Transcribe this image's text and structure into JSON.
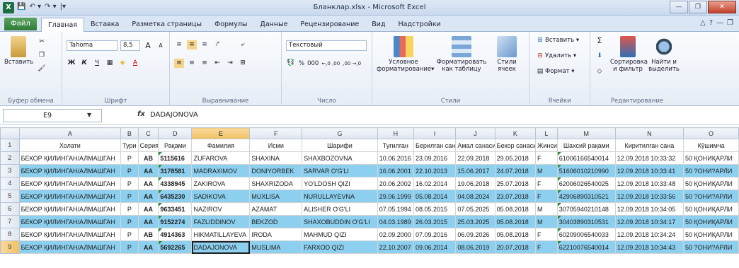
{
  "window": {
    "title": "Бланклар.xlsx - Microsoft Excel",
    "logo": "X",
    "qat": [
      "💾",
      "↶ ▾",
      "↷ ▾",
      "|▾"
    ],
    "buttons": {
      "minimize": "—",
      "restore": "❐",
      "close": "✕"
    }
  },
  "tabs": {
    "file": "Файл",
    "items": [
      "Главная",
      "Вставка",
      "Разметка страницы",
      "Формулы",
      "Данные",
      "Рецензирование",
      "Вид",
      "Надстройки"
    ],
    "help": [
      "△",
      "?",
      "—",
      "❐"
    ]
  },
  "ribbon": {
    "clipboard": {
      "label": "Буфер обмена",
      "paste": "Вставить"
    },
    "font": {
      "label": "Шрифт",
      "name": "Tahoma",
      "size": "8,5",
      "bold": "Ж",
      "italic": "К",
      "underline": "Ч",
      "grow": "A",
      "shrink": "A"
    },
    "alignment": {
      "label": "Выравнивание"
    },
    "number": {
      "label": "Число",
      "format": "Текстовый",
      "percent": "%",
      "thousands": "000",
      "inc": "←,0 ,00",
      "dec": ",00 →,0"
    },
    "styles": {
      "label": "Стили",
      "conditional": "Условное форматирование",
      "conditional_arrow": "▾",
      "as_table": "Форматировать как таблицу",
      "cell_styles": "Стили ячеек"
    },
    "cells": {
      "label": "Ячейки",
      "insert": "Вставить",
      "delete": "Удалить",
      "format": "Формат"
    },
    "editing": {
      "label": "Редактирование",
      "sum": "Σ",
      "sort": "Сортировка и фильтр",
      "find": "Найти и выделить"
    }
  },
  "formula_bar": {
    "cell": "E9",
    "fx": "fx",
    "value": "DADAJONOVA"
  },
  "sheet": {
    "columns": [
      "A",
      "B",
      "C",
      "D",
      "E",
      "F",
      "G",
      "H",
      "I",
      "J",
      "K",
      "L",
      "M",
      "N",
      "O"
    ],
    "header_row": [
      "Холати",
      "Тури",
      "Серия",
      "Рақами",
      "Фамилия",
      "Исми",
      "Шарифи",
      "Туғилган",
      "Берилган сана",
      "Амал санаси",
      "Бекор санаси",
      "Жинси",
      "Шахсий рақами",
      "Киритилган сана",
      "Кўшимча"
    ],
    "rows": [
      [
        "БЕКОР ҚИЛИНГАН/АЛМАШГАН",
        "P",
        "AB",
        "5115616",
        "ZUFAROVA",
        "SHAXINA",
        "SHAXBOZOVNA",
        "10.06.2016",
        "23.09.2016",
        "22.09.2018",
        "29.05.2018",
        "F",
        "61006166540014",
        "12.09.2018 10:33:32",
        "50 ҚОНИҚАРЛИ"
      ],
      [
        "БЕКОР ҚИЛИНГАН/АЛМАШГАН",
        "P",
        "AA",
        "3178581",
        "MADRAXIMOV",
        "DONIYORBEK",
        "SARVAR O'G'LI",
        "16.06.2001",
        "22.10.2013",
        "15.06.2017",
        "24.07.2018",
        "M",
        "51606010210990",
        "12.09.2018 10:33:41",
        "50 ?ОНИ?АРЛИ"
      ],
      [
        "БЕКОР ҚИЛИНГАН/АЛМАШГАН",
        "P",
        "AA",
        "4338945",
        "ZAKIROVA",
        "SHAXRIZODA",
        "YO'LDOSH QIZI",
        "20.06.2002",
        "16.02.2014",
        "19.06.2018",
        "25.07.2018",
        "F",
        "62006026540025",
        "12.09.2018 10:33:48",
        "50 ҚОНИҚАРЛИ"
      ],
      [
        "БЕКОР ҚИЛИНГАН/АЛМАШГАН",
        "P",
        "AA",
        "6435230",
        "SADIKOVA",
        "MUXLISA",
        "NURULLAYEVNA",
        "29.06.1999",
        "05.08.2014",
        "04.08.2024",
        "23.07.2018",
        "F",
        "42906890310521",
        "12.09.2018 10:33:56",
        "50 ?ОНИ?АРЛИ"
      ],
      [
        "БЕКОР ҚИЛИНГАН/АЛМАШГАН",
        "P",
        "AA",
        "9633451",
        "NAZIROV",
        "AZAMAT",
        "ALISHER O'G'LI",
        "07.05.1994",
        "08.05.2015",
        "07.05.2025",
        "05.08.2018",
        "M",
        "30705940210148",
        "12.09.2018 10:34:05",
        "50 ҚОНИҚАРЛИ"
      ],
      [
        "БЕКОР ҚИЛИНГАН/АЛМАШГАН",
        "P",
        "AA",
        "9152274",
        "FAZLIDDINOV",
        "BEKZOD",
        "SHAXOBUDDIN O'G'LI",
        "04.03.1989",
        "26.03.2015",
        "25.03.2025",
        "05.08.2018",
        "M",
        "30403890310531",
        "12.09.2018 10:34:17",
        "50 ҚОНИҚАРЛИ"
      ],
      [
        "БЕКОР ҚИЛИНГАН/АЛМАШГАН",
        "P",
        "AB",
        "4914363",
        "HIKMATILLAYEVA",
        "IRODA",
        "MAHMUD QIZI",
        "02.09.2000",
        "07.09.2016",
        "06.09.2026",
        "05.08.2018",
        "F",
        "60209006540033",
        "12.09.2018 10:34:24",
        "50 ҚОНИҚАРЛИ"
      ],
      [
        "БЕКОР ҚИЛИНГАН/АЛМАШГАН",
        "P",
        "AA",
        "5692265",
        "DADAJONOVA",
        "MUSLIMA",
        "FARXOD QIZI",
        "22.10.2007",
        "09.06.2014",
        "08.06.2019",
        "20.07.2018",
        "F",
        "62210076540014",
        "12.09.2018 10:34:43",
        "50 ?ОНИ?АРЛИ"
      ]
    ],
    "highlight_rows": [
      2,
      4,
      6,
      8
    ],
    "selected_cell": "E9",
    "highlight_color": "#8ccfef"
  }
}
